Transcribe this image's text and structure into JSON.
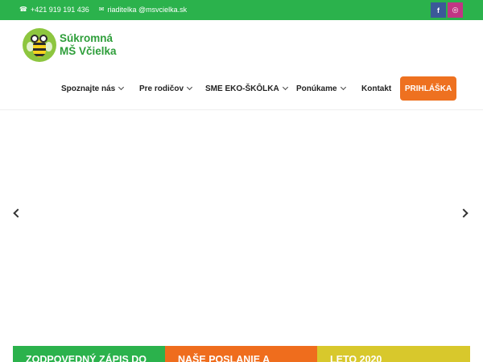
{
  "topbar": {
    "phone": "+421 919 191 436",
    "email": "riaditelka @msvcielka.sk",
    "social": {
      "facebook": "f",
      "instagram": "◎"
    }
  },
  "logo": {
    "line1": "Súkromná",
    "line2": "MŠ Včielka"
  },
  "nav": {
    "items": [
      {
        "label": "Spoznajte nás",
        "dropdown": true
      },
      {
        "label": "Pre rodičov",
        "dropdown": true
      },
      {
        "label": "SME EKO-ŠKÔLKA",
        "dropdown": true
      },
      {
        "label": "Ponúkame",
        "dropdown": true
      },
      {
        "label": "Kontakt",
        "dropdown": false
      }
    ],
    "cta": "PRIHLÁŠKA"
  },
  "boxes": [
    {
      "title": "ZODPOVEDNÝ ZÁPIS DO",
      "color": "#2bb24c"
    },
    {
      "title": "NAŠE POSLANIE A",
      "color": "#ef6d1d"
    },
    {
      "title": "LETO 2020",
      "color": "#d8c82c"
    }
  ],
  "colors": {
    "brand_green": "#2bb24c",
    "accent_orange": "#ee7120",
    "accent_yellow": "#d8c82c"
  }
}
